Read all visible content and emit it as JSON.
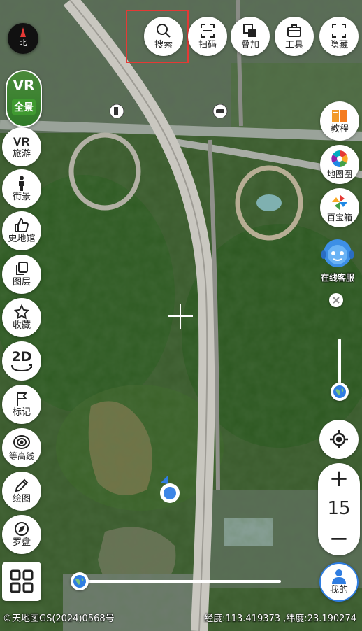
{
  "top_bar": [
    {
      "key": "search",
      "label": "搜索",
      "icon": "search-icon"
    },
    {
      "key": "scan",
      "label": "扫码",
      "icon": "scan-icon"
    },
    {
      "key": "overlay",
      "label": "叠加",
      "icon": "layers-copy-icon"
    },
    {
      "key": "tools",
      "label": "工具",
      "icon": "briefcase-icon"
    },
    {
      "key": "hide",
      "label": "隐藏",
      "icon": "fullscreen-icon"
    }
  ],
  "compass_label": "北",
  "vr_panorama": {
    "vr": "VR",
    "label": "全景"
  },
  "left_menu": [
    {
      "key": "travel",
      "label": "旅游",
      "icon": "vr-icon"
    },
    {
      "key": "street",
      "label": "街景",
      "icon": "person-icon"
    },
    {
      "key": "history",
      "label": "史地馆",
      "icon": "thumbs-up-icon"
    },
    {
      "key": "layers",
      "label": "图层",
      "icon": "layers-icon"
    },
    {
      "key": "favorites",
      "label": "收藏",
      "icon": "star-icon"
    },
    {
      "key": "mode",
      "label": "2D",
      "icon": "rotate-2d-icon"
    },
    {
      "key": "mark",
      "label": "标记",
      "icon": "flag-icon"
    },
    {
      "key": "contour",
      "label": "等高线",
      "icon": "contour-icon"
    },
    {
      "key": "draw",
      "label": "绘图",
      "icon": "pencil-icon"
    },
    {
      "key": "compass",
      "label": "罗盘",
      "icon": "compass-icon"
    }
  ],
  "right_menu": [
    {
      "key": "tutorial",
      "label": "教程",
      "icon": "book-icon"
    },
    {
      "key": "map_circle",
      "label": "地图圈",
      "icon": "aperture-icon"
    },
    {
      "key": "toolbox",
      "label": "百宝箱",
      "icon": "pinwheel-icon"
    }
  ],
  "customer_service": {
    "label": "在线客服"
  },
  "zoom": {
    "level": "15",
    "plus": "+",
    "minus": "−"
  },
  "me": {
    "label": "我的"
  },
  "footer": {
    "copyright": "©天地图GS(2024)0568号",
    "coordinates": "经度:113.419373 ,纬度:23.190274"
  },
  "colors": {
    "accent": "#2f7de1",
    "highlight": "#e53935"
  }
}
